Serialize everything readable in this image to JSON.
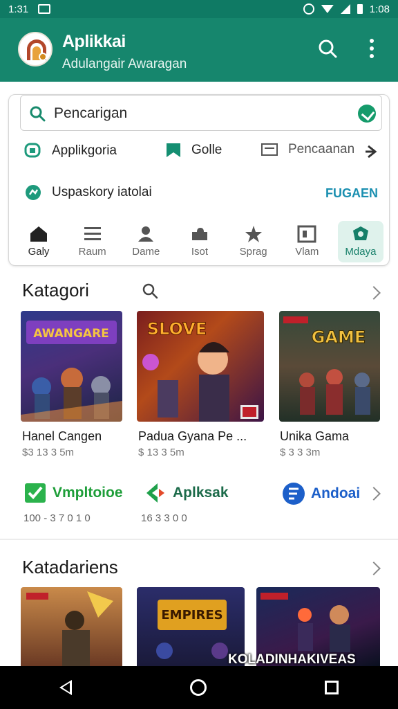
{
  "status_bar": {
    "time": "1:31",
    "right_time": "1:08"
  },
  "app": {
    "title": "Aplikkai",
    "subtitle": "Adulangair Awaragan"
  },
  "search": {
    "text": "Pencarigan"
  },
  "quick_links": [
    {
      "label": "Applikgoria"
    },
    {
      "label": "Golle"
    },
    {
      "label": "Pencaanan"
    }
  ],
  "quick_row2": {
    "label": "Uspaskory iatolai",
    "link": "FUGAEN"
  },
  "categories": [
    {
      "label": "Galy"
    },
    {
      "label": "Raum"
    },
    {
      "label": "Dame"
    },
    {
      "label": "Isot"
    },
    {
      "label": "Sprag"
    },
    {
      "label": "Vlam"
    },
    {
      "label": "Mdaya"
    }
  ],
  "section1": {
    "title": "Katagori",
    "tiles": [
      {
        "name": "Hanel Cangen",
        "meta": "$3 13 3 5m",
        "art_text": "AWANGARE"
      },
      {
        "name": "Padua Gyana Pe ...",
        "meta": "$ 13 3 5m",
        "art_text": "SLOVE"
      },
      {
        "name": "Unika Gama",
        "meta": "$ 3 3 3m",
        "art_text": "GAME"
      }
    ]
  },
  "apps": [
    {
      "name": "Vmpltoioe",
      "meta": "100 - 3 7 0 1 0"
    },
    {
      "name": "Aplksak",
      "meta": "16 3 3 0 0"
    },
    {
      "name": "Andoai",
      "meta": ""
    }
  ],
  "section2": {
    "title": "Katadariens",
    "banner": "KOLADINHAKIVEAS",
    "art_text": "EMPIRES"
  },
  "colors": {
    "primary": "#16866d",
    "status": "#0f7a64",
    "accent_link": "#1a8fb0"
  }
}
